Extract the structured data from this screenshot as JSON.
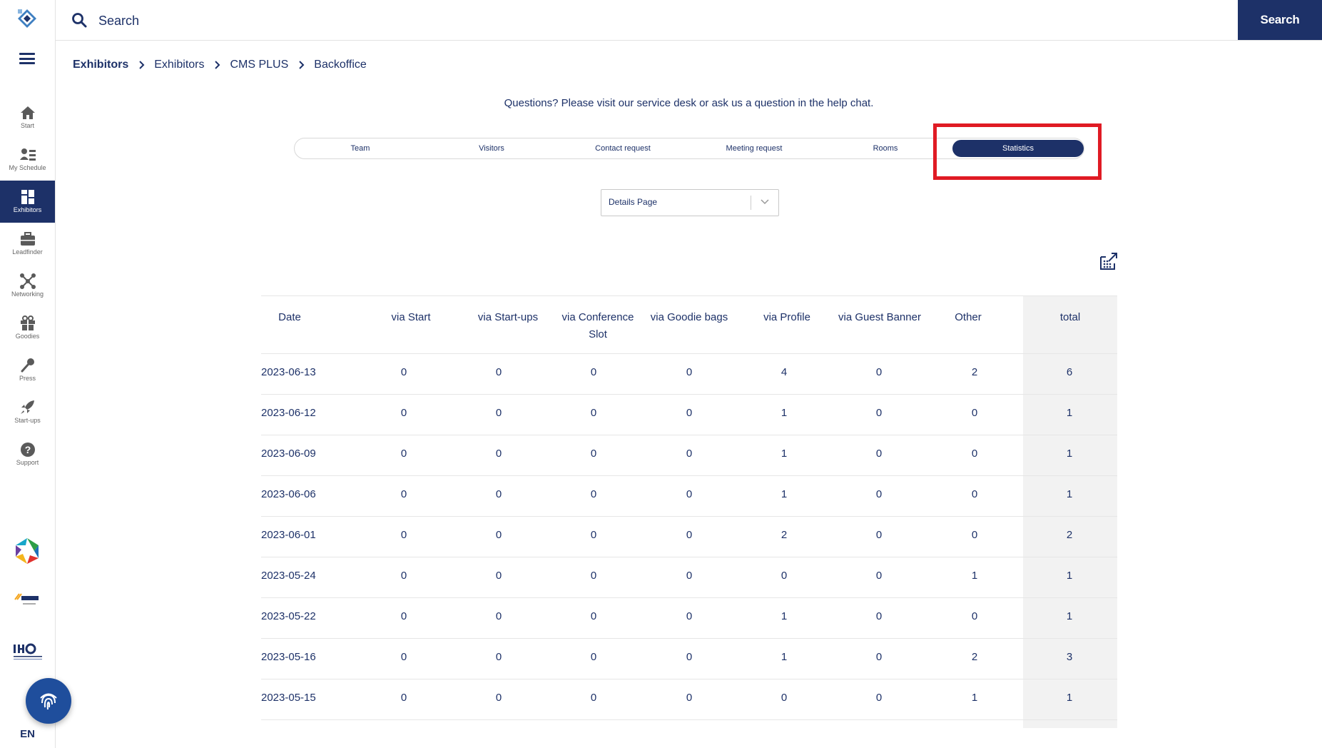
{
  "sidebar": {
    "items": [
      {
        "label": "Start",
        "icon": "home-icon"
      },
      {
        "label": "My Schedule",
        "icon": "schedule-icon"
      },
      {
        "label": "Exhibitors",
        "icon": "exhibitors-icon",
        "active": true
      },
      {
        "label": "Leadfinder",
        "icon": "briefcase-icon"
      },
      {
        "label": "Networking",
        "icon": "network-icon"
      },
      {
        "label": "Goodies",
        "icon": "gift-icon"
      },
      {
        "label": "Press",
        "icon": "microphone-icon"
      },
      {
        "label": "Start-ups",
        "icon": "rocket-icon"
      },
      {
        "label": "Support",
        "icon": "help-icon"
      }
    ],
    "language": "EN"
  },
  "header": {
    "search_placeholder": "Search",
    "search_button": "Search"
  },
  "breadcrumb": [
    "Exhibitors",
    "Exhibitors",
    "CMS PLUS",
    "Backoffice"
  ],
  "help_text": "Questions? Please visit our service desk or ask us a question in the help chat.",
  "tabs": [
    "Team",
    "Visitors",
    "Contact request",
    "Meeting request",
    "Rooms",
    "Statistics"
  ],
  "active_tab": "Statistics",
  "dropdown": {
    "selected": "Details Page"
  },
  "table": {
    "headers": [
      "Date",
      "via Start",
      "via Start-ups",
      "via Conference Slot",
      "via Goodie bags",
      "via Profile",
      "via Guest Banner",
      "Other",
      "total"
    ],
    "rows": [
      [
        "2023-06-13",
        "0",
        "0",
        "0",
        "0",
        "4",
        "0",
        "2",
        "6"
      ],
      [
        "2023-06-12",
        "0",
        "0",
        "0",
        "0",
        "1",
        "0",
        "0",
        "1"
      ],
      [
        "2023-06-09",
        "0",
        "0",
        "0",
        "0",
        "1",
        "0",
        "0",
        "1"
      ],
      [
        "2023-06-06",
        "0",
        "0",
        "0",
        "0",
        "1",
        "0",
        "0",
        "1"
      ],
      [
        "2023-06-01",
        "0",
        "0",
        "0",
        "0",
        "2",
        "0",
        "0",
        "2"
      ],
      [
        "2023-05-24",
        "0",
        "0",
        "0",
        "0",
        "0",
        "0",
        "1",
        "1"
      ],
      [
        "2023-05-22",
        "0",
        "0",
        "0",
        "0",
        "1",
        "0",
        "0",
        "1"
      ],
      [
        "2023-05-16",
        "0",
        "0",
        "0",
        "0",
        "1",
        "0",
        "2",
        "3"
      ],
      [
        "2023-05-15",
        "0",
        "0",
        "0",
        "0",
        "0",
        "0",
        "1",
        "1"
      ]
    ]
  },
  "colors": {
    "primary": "#1d3168",
    "highlight": "#e01b24",
    "total_column_bg": "#f2f2f2"
  }
}
